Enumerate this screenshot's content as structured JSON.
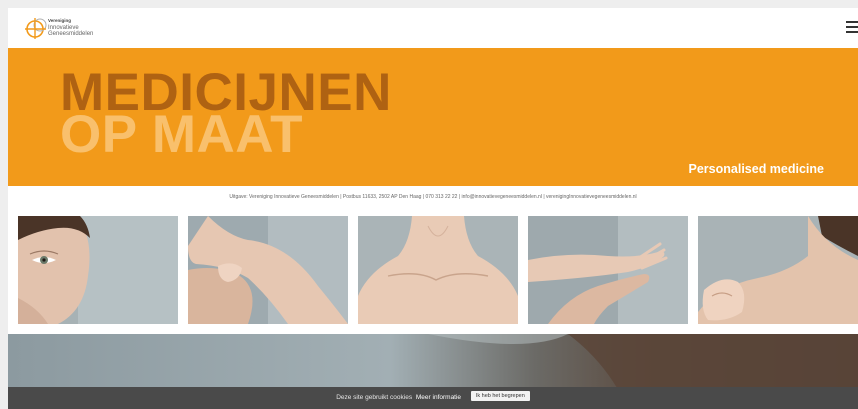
{
  "header": {
    "logo": {
      "line1": "Vereniging",
      "line2": "Innovatieve",
      "line3": "Geneesmiddelen"
    },
    "menu_icon": "hamburger-menu-icon"
  },
  "hero": {
    "title_line1": "MEDICIJNEN",
    "title_line2": "OP MAAT",
    "tagline": "Personalised medicine",
    "background_color": "#f29a1a"
  },
  "contact_line": "Uitgave: Vereniging Innovatieve Geneesmiddelen | Postbus 11633, 2502 AP Den Haag | 070 313 22 22 | info@innovatievegeneesmiddelen.nl | verenigingInnovatievegeneesmiddelen.nl",
  "gallery": {
    "photos": [
      "face-photo",
      "arm-photo",
      "chest-photo",
      "hands-photo",
      "shoulder-photo"
    ]
  },
  "cookie_bar": {
    "message": "Deze site gebruikt cookies",
    "more_info_link": "Meer informatie",
    "accept_button": "Ik heb het begrepen"
  }
}
